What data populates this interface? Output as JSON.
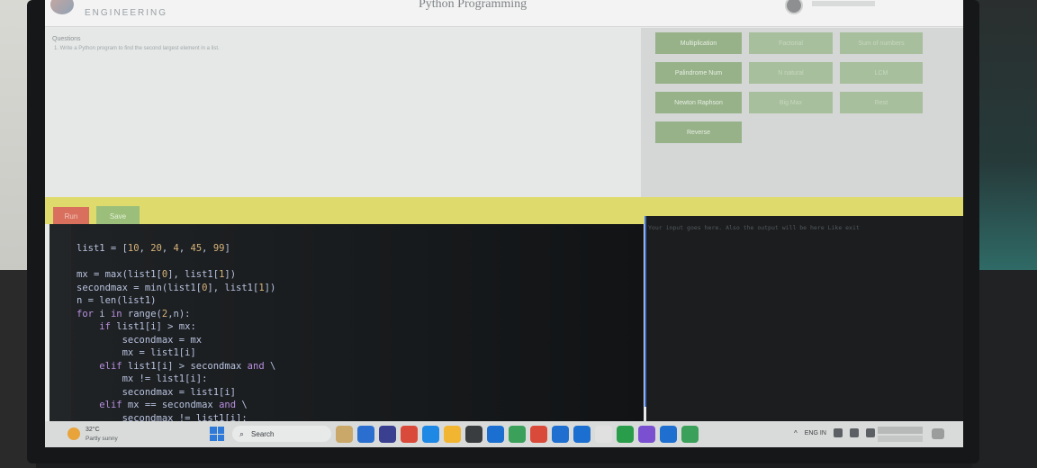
{
  "header": {
    "brand": "ENGINEERING",
    "title": "Python Programming"
  },
  "question": {
    "heading": "Questions",
    "text": "1. Write a Python program to find the second largest element in a list."
  },
  "programs": [
    {
      "label": "Multiplication",
      "faded": false
    },
    {
      "label": "Factorial",
      "faded": true
    },
    {
      "label": "Sum of numbers",
      "faded": true
    },
    {
      "label": "Palindrome Num",
      "faded": false
    },
    {
      "label": "N natural",
      "faded": true
    },
    {
      "label": "LCM",
      "faded": true
    },
    {
      "label": "Newton Raphson",
      "faded": false
    },
    {
      "label": "Big Max",
      "faded": true
    },
    {
      "label": "Rest",
      "faded": true
    },
    {
      "label": "Reverse",
      "faded": false
    }
  ],
  "toolbar": {
    "run_label": "Run",
    "save_label": "Save"
  },
  "editor": {
    "lines": [
      [
        [
          "plain",
          "list1 = ["
        ],
        [
          "num",
          "10"
        ],
        [
          "plain",
          ", "
        ],
        [
          "num",
          "20"
        ],
        [
          "plain",
          ", "
        ],
        [
          "num",
          "4"
        ],
        [
          "plain",
          ", "
        ],
        [
          "num",
          "45"
        ],
        [
          "plain",
          ", "
        ],
        [
          "num",
          "99"
        ],
        [
          "plain",
          "]"
        ]
      ],
      [
        [
          "plain",
          ""
        ]
      ],
      [
        [
          "plain",
          "mx = max(list1["
        ],
        [
          "num",
          "0"
        ],
        [
          "plain",
          "], list1["
        ],
        [
          "num",
          "1"
        ],
        [
          "plain",
          "])"
        ]
      ],
      [
        [
          "plain",
          "secondmax = min(list1["
        ],
        [
          "num",
          "0"
        ],
        [
          "plain",
          "], list1["
        ],
        [
          "num",
          "1"
        ],
        [
          "plain",
          "])"
        ]
      ],
      [
        [
          "plain",
          "n = len(list1)"
        ]
      ],
      [
        [
          "kw",
          "for"
        ],
        [
          "plain",
          " i "
        ],
        [
          "kw",
          "in"
        ],
        [
          "plain",
          " range("
        ],
        [
          "num",
          "2"
        ],
        [
          "plain",
          ",n):"
        ]
      ],
      [
        [
          "plain",
          "    "
        ],
        [
          "kw",
          "if"
        ],
        [
          "plain",
          " list1[i] > mx:"
        ]
      ],
      [
        [
          "plain",
          "        secondmax = mx"
        ]
      ],
      [
        [
          "plain",
          "        mx = list1[i]"
        ]
      ],
      [
        [
          "plain",
          "    "
        ],
        [
          "kw",
          "elif"
        ],
        [
          "plain",
          " list1[i] > secondmax "
        ],
        [
          "kw",
          "and"
        ],
        [
          "plain",
          " \\"
        ]
      ],
      [
        [
          "plain",
          "        mx != list1[i]:"
        ]
      ],
      [
        [
          "plain",
          "        secondmax = list1[i]"
        ]
      ],
      [
        [
          "plain",
          "    "
        ],
        [
          "kw",
          "elif"
        ],
        [
          "plain",
          " mx == secondmax "
        ],
        [
          "kw",
          "and"
        ],
        [
          "plain",
          " \\"
        ]
      ],
      [
        [
          "plain",
          "        secondmax != list1[i]:"
        ]
      ]
    ]
  },
  "output": {
    "text": "Your input goes here. Also the output will be here Like exit"
  },
  "taskbar": {
    "temperature": "32°C",
    "weather": "Partly sunny",
    "search_label": "Search",
    "tray_lang": "ENG IN",
    "app_colors": [
      "#c9a86a",
      "#2a6fd0",
      "#3a3f8f",
      "#d94a3a",
      "#1e88e5",
      "#f2b531",
      "#3a3d40",
      "#1b6fd0",
      "#3aa05a",
      "#d94a3a",
      "#1e6fd0",
      "#1b6fd0",
      "#e0e0e0",
      "#2a9d4a",
      "#7a4fd0",
      "#1e6fd0",
      "#3aa05a"
    ]
  }
}
